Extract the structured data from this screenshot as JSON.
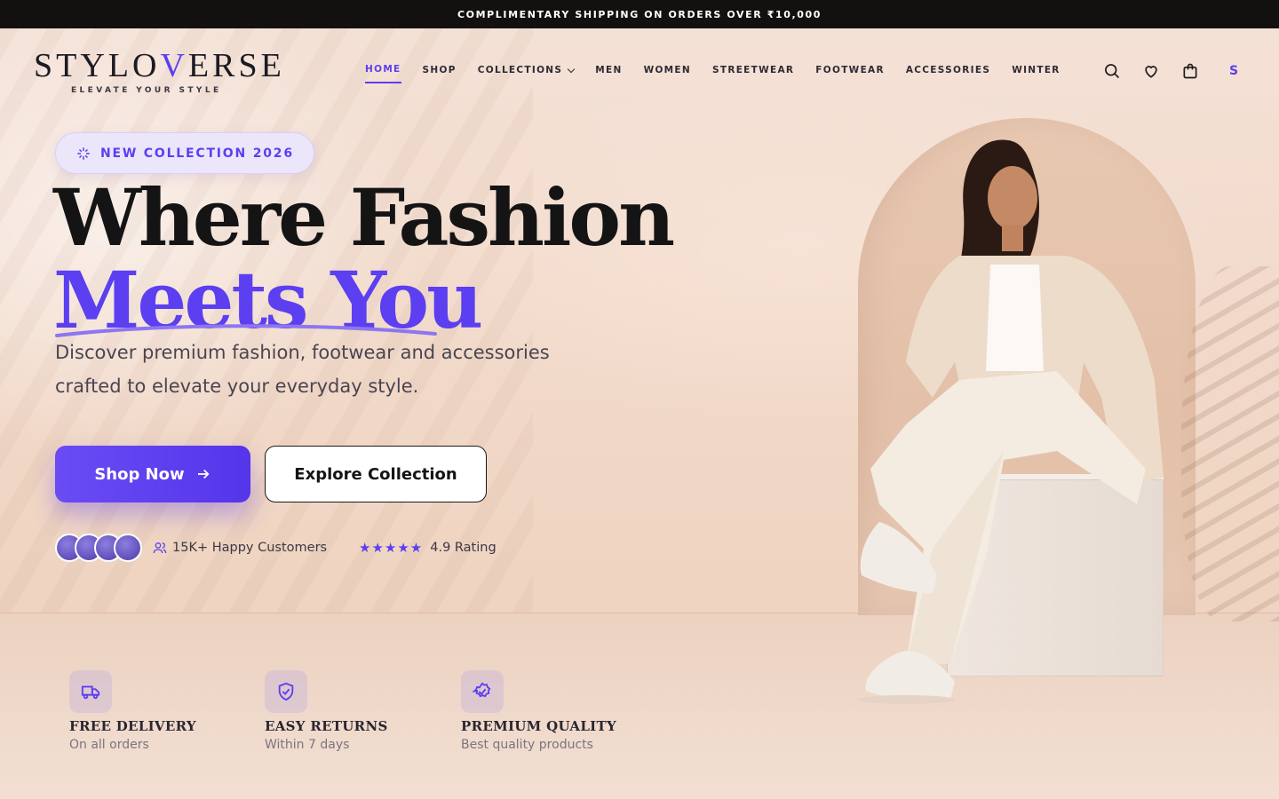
{
  "announcement": "COMPLIMENTARY SHIPPING ON ORDERS OVER ₹10,000",
  "brand": {
    "name_pre": "STYLO",
    "name_v": "V",
    "name_post": "ERSE",
    "tagline": "ELEVATE YOUR STYLE"
  },
  "nav": {
    "items": [
      {
        "label": "HOME",
        "active": true
      },
      {
        "label": "SHOP"
      },
      {
        "label": "COLLECTIONS",
        "dropdown": true
      },
      {
        "label": "MEN"
      },
      {
        "label": "WOMEN"
      },
      {
        "label": "STREETWEAR"
      },
      {
        "label": "FOOTWEAR"
      },
      {
        "label": "ACCESSORIES"
      },
      {
        "label": "WINTER"
      }
    ]
  },
  "header_icons": {
    "search": "search-icon",
    "wishlist": "heart-icon",
    "cart": "bag-icon",
    "account_initial": "S"
  },
  "hero": {
    "badge": "NEW COLLECTION 2026",
    "title_line1": "Where Fashion",
    "title_line2": "Meets You",
    "subtitle": "Discover premium fashion, footwear and accessories crafted to elevate your everyday style.",
    "primary_cta": "Shop Now",
    "secondary_cta": "Explore Collection",
    "customers": "15K+ Happy Customers",
    "rating": "4.9 Rating"
  },
  "features": [
    {
      "title": "FREE DELIVERY",
      "sub": "On all orders",
      "icon": "truck-icon"
    },
    {
      "title": "EASY RETURNS",
      "sub": "Within 7 days",
      "icon": "shield-check-icon"
    },
    {
      "title": "PREMIUM QUALITY",
      "sub": "Best quality products",
      "icon": "badge-check-icon"
    }
  ],
  "colors": {
    "accent": "#5b3ff0",
    "dark": "#141414",
    "announce_bg": "#121110"
  }
}
